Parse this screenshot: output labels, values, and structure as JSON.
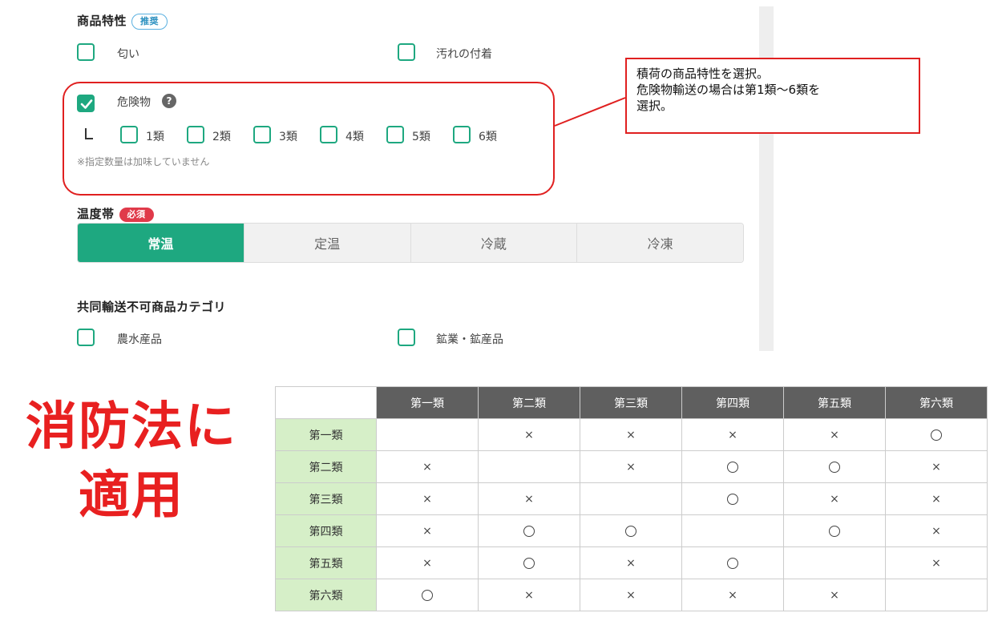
{
  "product_features": {
    "title": "商品特性",
    "badge": "推奨",
    "options": {
      "smell": "匂い",
      "dirt": "汚れの付着",
      "hazardous": "危険物"
    },
    "hazardous_checked": true,
    "help_icon": "?",
    "classes": [
      "1類",
      "2類",
      "3類",
      "4類",
      "5類",
      "6類"
    ],
    "note": "※指定数量は加味していません"
  },
  "callout": {
    "lines": [
      "積荷の商品特性を選択。",
      "危険物輸送の場合は第1類〜6類を",
      "選択。"
    ]
  },
  "temperature": {
    "title": "温度帯",
    "badge": "必須",
    "options": [
      "常温",
      "定温",
      "冷蔵",
      "冷凍"
    ],
    "selected": "常温"
  },
  "joint_transport": {
    "title": "共同輸送不可商品カテゴリ",
    "options": {
      "agri": "農水産品",
      "mining": "鉱業・鉱産品"
    }
  },
  "fire_law": {
    "line1": "消防法に",
    "line2": "適用"
  },
  "table": {
    "columns": [
      "第一類",
      "第二類",
      "第三類",
      "第四類",
      "第五類",
      "第六類"
    ],
    "rows": [
      {
        "label": "第一類",
        "cells": [
          "",
          "×",
          "×",
          "×",
          "×",
          "○"
        ]
      },
      {
        "label": "第二類",
        "cells": [
          "×",
          "",
          "×",
          "○",
          "○",
          "×"
        ]
      },
      {
        "label": "第三類",
        "cells": [
          "×",
          "×",
          "",
          "○",
          "×",
          "×"
        ]
      },
      {
        "label": "第四類",
        "cells": [
          "×",
          "○",
          "○",
          "",
          "○",
          "×"
        ]
      },
      {
        "label": "第五類",
        "cells": [
          "×",
          "○",
          "×",
          "○",
          "",
          "×"
        ]
      },
      {
        "label": "第六類",
        "cells": [
          "○",
          "×",
          "×",
          "×",
          "×",
          ""
        ]
      }
    ]
  },
  "colors": {
    "accent": "#1ea880",
    "required": "#e03a4a",
    "highlight": "#e02020",
    "row_head": "#d6efc8",
    "col_head": "#5f5f5f"
  }
}
